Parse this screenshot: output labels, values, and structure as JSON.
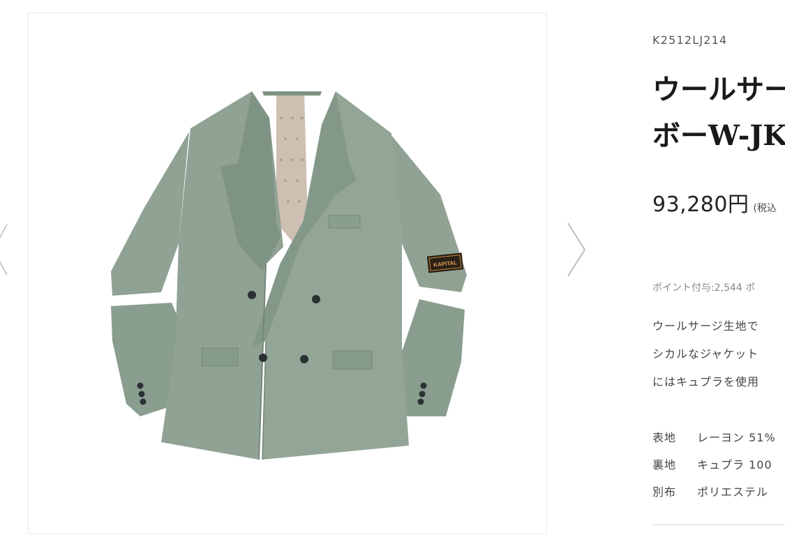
{
  "product": {
    "sku": "K2512LJ214",
    "title_lines": [
      "ウールサー",
      "ボーW-JK"
    ],
    "price": "93,280円",
    "tax_note": "(税込",
    "points": "ポイント付与:2,544 ポ",
    "description_lines": [
      "ウールサージ生地で",
      "シカルなジャケット",
      "にはキュプラを使用"
    ],
    "materials": [
      {
        "label": "表地",
        "value": "レーヨン 51%"
      },
      {
        "label": "裏地",
        "value": "キュプラ 100"
      },
      {
        "label": "別布",
        "value": "ポリエステル"
      }
    ]
  },
  "gallery": {
    "patch_text": "KAPITAL",
    "colors": {
      "jacket": "#8fa294",
      "jacket_shadow": "#74887a",
      "lining": "#cdbfb2",
      "buttons": "#2b3033"
    }
  }
}
